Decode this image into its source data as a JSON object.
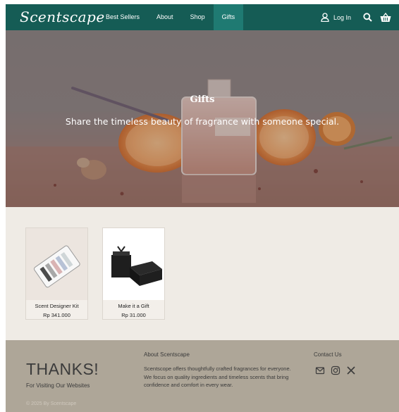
{
  "nav": {
    "logo": "Scentscape",
    "menu": [
      "Best Sellers",
      "About",
      "Shop",
      "Gifts"
    ],
    "active": "Gifts",
    "login_label": "Log In"
  },
  "hero": {
    "title": "Gifts",
    "subtitle": "Share the timeless beauty of fragrance with someone special."
  },
  "products": [
    {
      "name": "Scent Designer Kit",
      "price": "Rp 341.000"
    },
    {
      "name": "Make it a Gift",
      "price": "Rp 31.000"
    }
  ],
  "footer": {
    "thanks": "THANKS!",
    "visit": "For Visiting Our Websites",
    "copyright": "© 2025 By Scentscape",
    "about_heading": "About Scentscape",
    "about_text": "Scentscope offers thoughtfully crafted fragrances for everyone. We focus on quality ingredients and timeless scents that bring confidence and comfort in every wear.",
    "contact_heading": "Contact Us",
    "socials": [
      "mail-icon",
      "instagram-icon",
      "x-icon"
    ]
  },
  "colors": {
    "nav_bg": "#155c55",
    "nav_active": "#1f7a72",
    "page_bg": "#efebe5",
    "footer_bg": "#aea698"
  }
}
